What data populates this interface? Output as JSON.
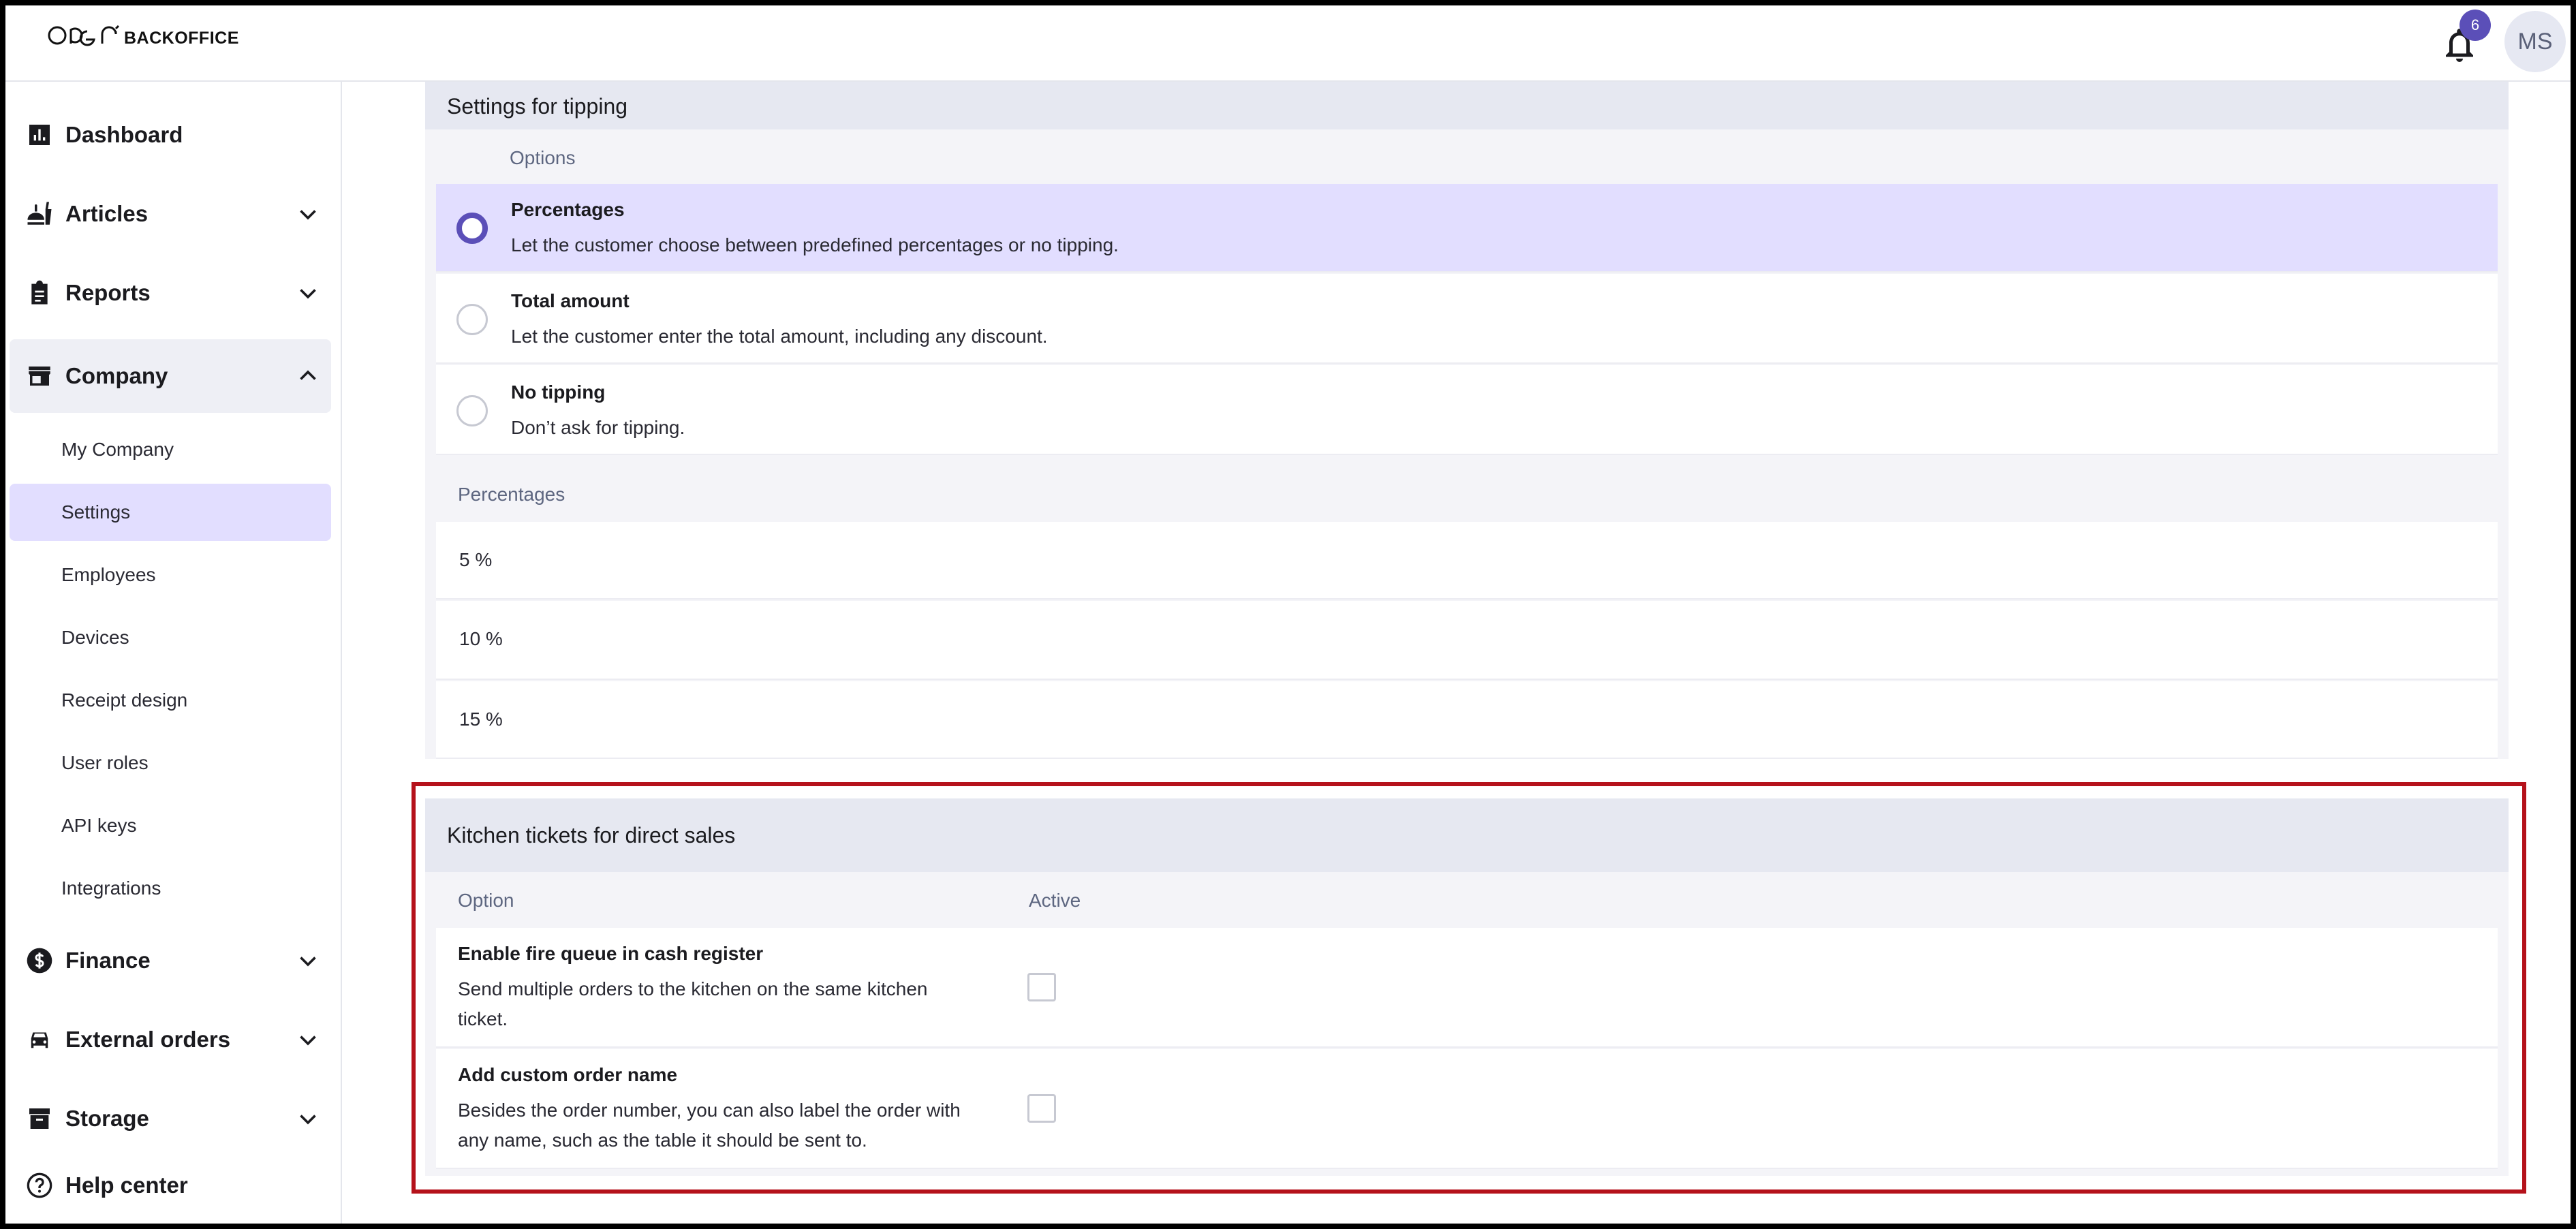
{
  "header": {
    "brand_text": "BACKOFFICE",
    "notification_count": "6",
    "avatar_initials": "MS"
  },
  "sidebar": {
    "items": [
      {
        "label": "Dashboard",
        "icon": "bar-chart-icon"
      },
      {
        "label": "Articles",
        "icon": "food-icon"
      },
      {
        "label": "Reports",
        "icon": "clipboard-icon"
      },
      {
        "label": "Company",
        "icon": "store-icon"
      },
      {
        "label": "Finance",
        "icon": "dollar-icon"
      },
      {
        "label": "External orders",
        "icon": "car-icon"
      },
      {
        "label": "Storage",
        "icon": "archive-icon"
      },
      {
        "label": "Help center",
        "icon": "help-icon"
      }
    ],
    "company_sub": [
      {
        "label": "My Company"
      },
      {
        "label": "Settings"
      },
      {
        "label": "Employees"
      },
      {
        "label": "Devices"
      },
      {
        "label": "Receipt design"
      },
      {
        "label": "User roles"
      },
      {
        "label": "API keys"
      },
      {
        "label": "Integrations"
      }
    ]
  },
  "tipping": {
    "title": "Settings for tipping",
    "options_header": "Options",
    "options": [
      {
        "title": "Percentages",
        "desc": "Let the customer choose between predefined percentages or no tipping."
      },
      {
        "title": "Total amount",
        "desc": "Let the customer enter the total amount, including any discount."
      },
      {
        "title": "No tipping",
        "desc": "Don’t ask for tipping."
      }
    ],
    "selected_option": "Percentages",
    "percentages_header": "Percentages",
    "percentages": [
      "5 %",
      "10 %",
      "15 %"
    ]
  },
  "kitchen": {
    "title": "Kitchen tickets for direct sales",
    "col_option": "Option",
    "col_active": "Active",
    "rows": [
      {
        "title": "Enable fire queue in cash register",
        "desc_line1": "Send multiple orders to the kitchen on the same kitchen",
        "desc_line2": "ticket.",
        "active": false
      },
      {
        "title": "Add custom order name",
        "desc_line1": "Besides the order number, you can also label the order with",
        "desc_line2": "any name, such as the table it should be sent to.",
        "active": false
      }
    ]
  },
  "colors": {
    "accent": "#5b4fb8",
    "selected_bg": "#e2deff",
    "highlight_border": "#b5121b"
  }
}
